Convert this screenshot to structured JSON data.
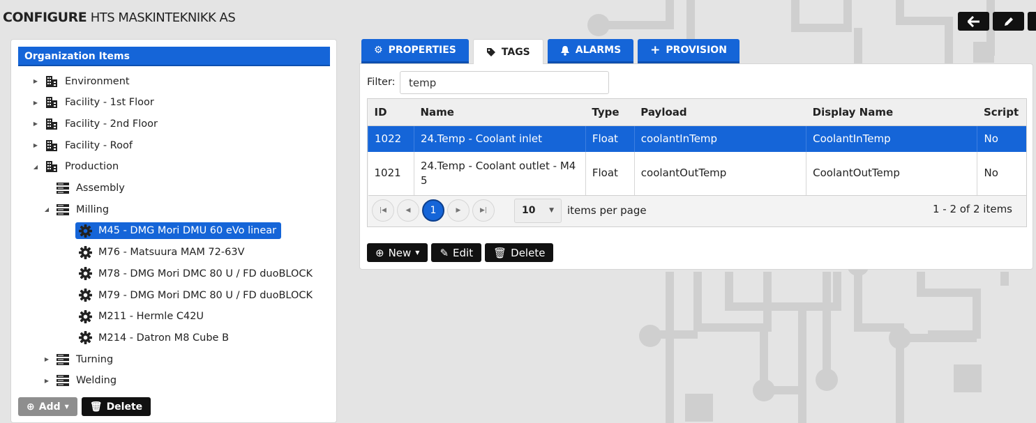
{
  "header": {
    "strong_title": "CONFIGURE",
    "org_name": "HTS MASKINTEKNIKK AS"
  },
  "top_buttons": [
    {
      "icon": "arrow-left-icon"
    },
    {
      "icon": "pencil-icon"
    }
  ],
  "left_panel": {
    "title": "Organization Items",
    "tree": [
      {
        "label": "Environment",
        "icon": "building-icon",
        "level": 0,
        "arrow": "collapsed"
      },
      {
        "label": "Facility - 1st Floor",
        "icon": "building-icon",
        "level": 0,
        "arrow": "collapsed"
      },
      {
        "label": "Facility - 2nd Floor",
        "icon": "building-icon",
        "level": 0,
        "arrow": "collapsed"
      },
      {
        "label": "Facility - Roof",
        "icon": "building-icon",
        "level": 0,
        "arrow": "collapsed"
      },
      {
        "label": "Production",
        "icon": "building-icon",
        "level": 0,
        "arrow": "expanded"
      },
      {
        "label": "Assembly",
        "icon": "server-icon",
        "level": 1,
        "arrow": "none"
      },
      {
        "label": "Milling",
        "icon": "server-icon",
        "level": 1,
        "arrow": "expanded"
      },
      {
        "label": "M45 - DMG Mori DMU 60 eVo linear",
        "icon": "gear-icon",
        "level": 2,
        "arrow": "none",
        "selected": true
      },
      {
        "label": "M76 - Matsuura MAM 72-63V",
        "icon": "gear-icon",
        "level": 2,
        "arrow": "none"
      },
      {
        "label": "M78 - DMG Mori DMC 80 U / FD duoBLOCK",
        "icon": "gear-icon",
        "level": 2,
        "arrow": "none"
      },
      {
        "label": "M79 - DMG Mori DMC 80 U / FD duoBLOCK",
        "icon": "gear-icon",
        "level": 2,
        "arrow": "none"
      },
      {
        "label": "M211 - Hermle C42U",
        "icon": "gear-icon",
        "level": 2,
        "arrow": "none"
      },
      {
        "label": "M214 - Datron M8 Cube B",
        "icon": "gear-icon",
        "level": 2,
        "arrow": "none"
      },
      {
        "label": "Turning",
        "icon": "server-icon",
        "level": 1,
        "arrow": "collapsed"
      },
      {
        "label": "Welding",
        "icon": "server-icon",
        "level": 1,
        "arrow": "collapsed"
      }
    ],
    "add_label": "Add",
    "delete_label": "Delete"
  },
  "tabs": [
    {
      "label": "PROPERTIES",
      "icon": "gear-icon",
      "active": false
    },
    {
      "label": "TAGS",
      "icon": "tag-icon",
      "active": true
    },
    {
      "label": "ALARMS",
      "icon": "bell-icon",
      "active": false
    },
    {
      "label": "PROVISION",
      "icon": "plus-icon",
      "active": false
    }
  ],
  "filter": {
    "label": "Filter:",
    "value": "temp"
  },
  "grid": {
    "columns": [
      "ID",
      "Name",
      "Type",
      "Payload",
      "Display Name",
      "Script"
    ],
    "rows": [
      {
        "id": "1022",
        "name": "24.Temp - Coolant inlet",
        "type": "Float",
        "payload": "coolantInTemp",
        "display_name": "CoolantInTemp",
        "script": "No",
        "selected": true
      },
      {
        "id": "1021",
        "name": "24.Temp - Coolant outlet - M45",
        "type": "Float",
        "payload": "coolantOutTemp",
        "display_name": "CoolantOutTemp",
        "script": "No",
        "selected": false
      }
    ],
    "pager": {
      "current_page": "1",
      "page_size": "10",
      "page_size_label": "items per page",
      "info": "1 - 2 of 2 items"
    }
  },
  "actions": {
    "new_label": "New",
    "edit_label": "Edit",
    "delete_label": "Delete"
  },
  "colors": {
    "accent": "#1565d8",
    "background": "#e4e4e4",
    "dark_button": "#111111"
  }
}
